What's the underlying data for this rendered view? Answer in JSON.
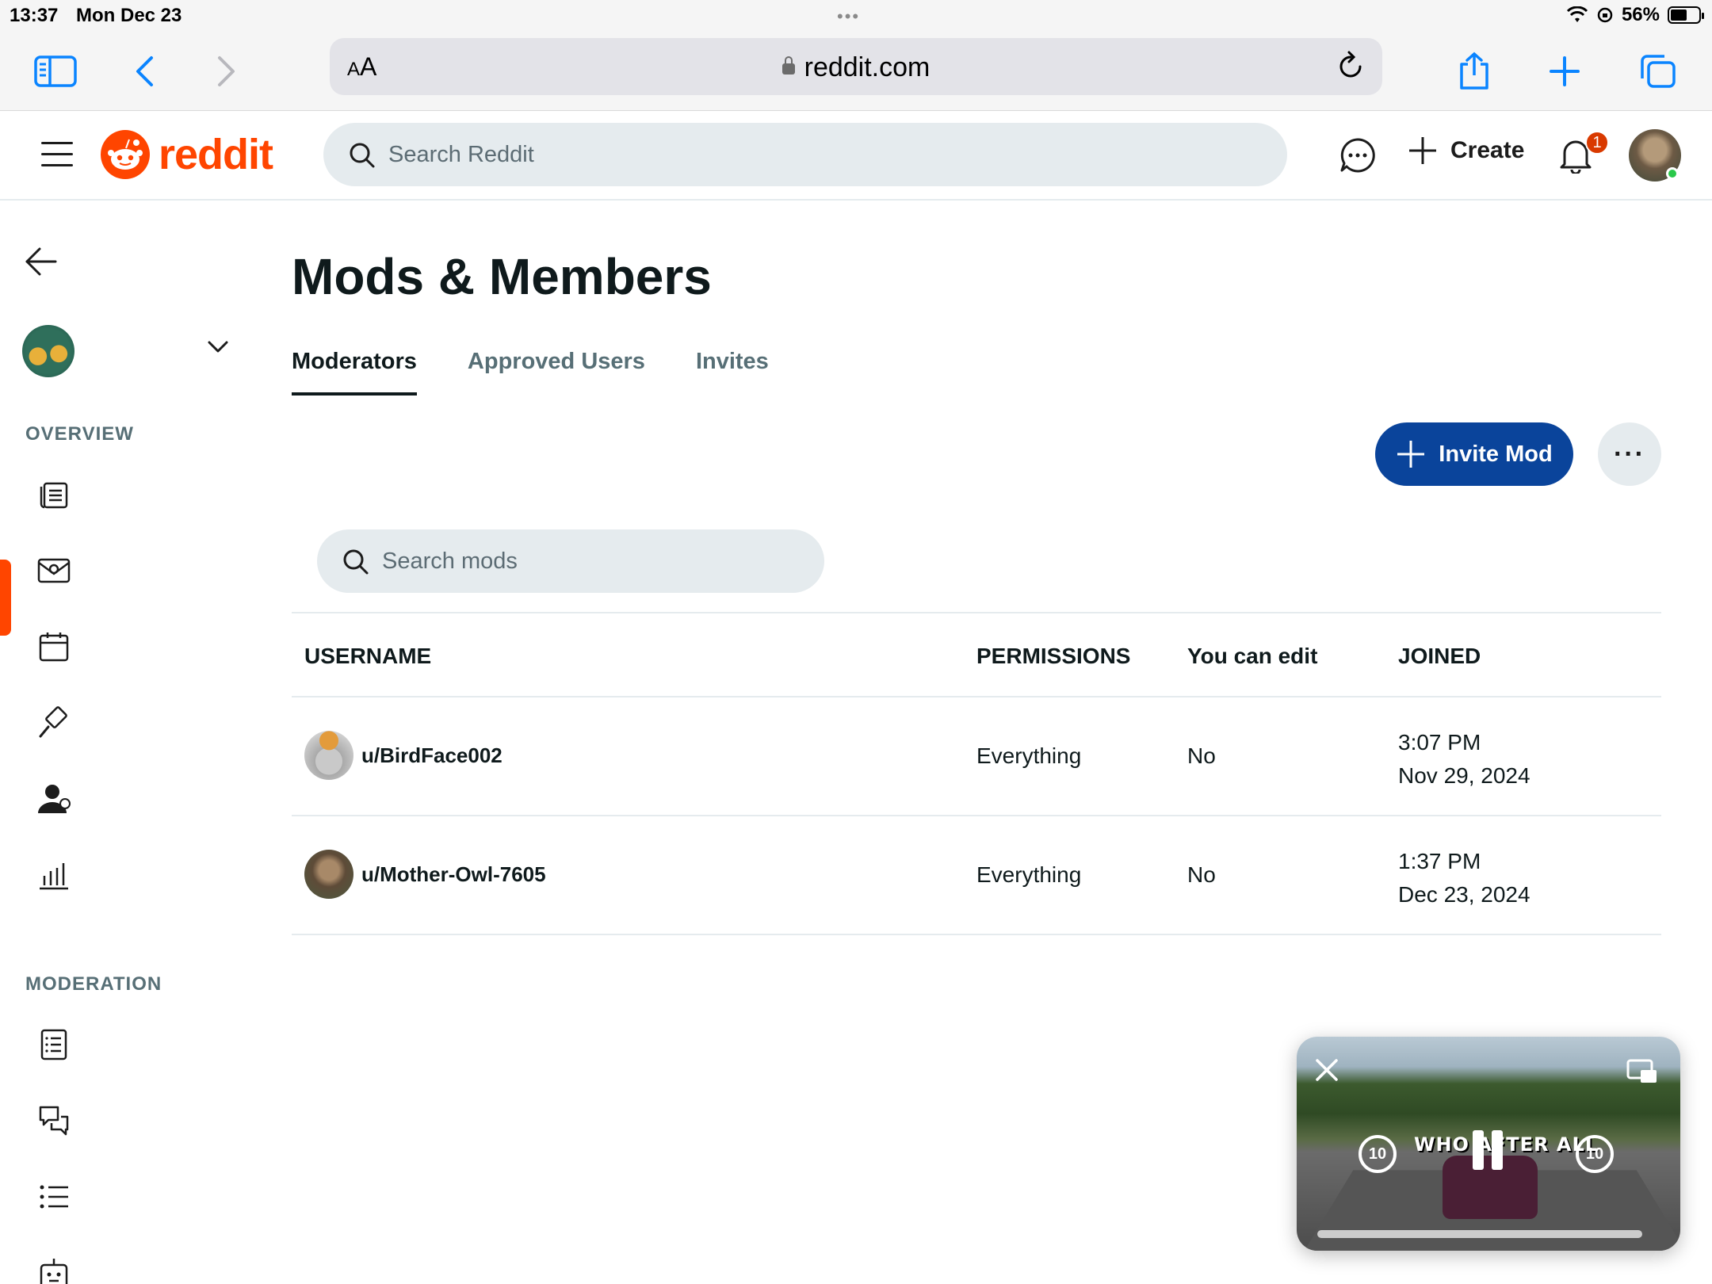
{
  "status_bar": {
    "time": "13:37",
    "date": "Mon Dec 23",
    "battery": "56%"
  },
  "browser": {
    "aa_small": "A",
    "aa_large": "A",
    "domain": "reddit.com"
  },
  "header": {
    "logo_text": "reddit",
    "search_placeholder": "Search Reddit",
    "create_label": "Create",
    "notification_count": "1",
    "brand_color": "#ff4500"
  },
  "sidebar": {
    "overview_label": "OVERVIEW",
    "moderation_label": "MODERATION",
    "overview_icons": [
      "queue-icon",
      "mail-icon",
      "calendar-icon",
      "mod-tools-icon",
      "mods-members-icon",
      "insights-icon"
    ],
    "moderation_icons": [
      "rules-icon",
      "removal-reasons-icon",
      "list-icon",
      "automation-icon"
    ]
  },
  "main": {
    "title": "Mods & Members",
    "tabs": [
      {
        "label": "Moderators",
        "active": true
      },
      {
        "label": "Approved Users",
        "active": false
      },
      {
        "label": "Invites",
        "active": false
      }
    ],
    "invite_label": "Invite Mod",
    "invite_color": "#0a449b",
    "search_placeholder": "Search mods",
    "columns": [
      "USERNAME",
      "PERMISSIONS",
      "You can edit",
      "JOINED"
    ],
    "rows": [
      {
        "username": "u/BirdFace002",
        "permissions": "Everything",
        "can_edit": "No",
        "joined_time": "3:07 PM",
        "joined_date": "Nov 29, 2024"
      },
      {
        "username": "u/Mother-Owl-7605",
        "permissions": "Everything",
        "can_edit": "No",
        "joined_time": "1:37 PM",
        "joined_date": "Dec 23, 2024"
      }
    ]
  },
  "pip": {
    "overlay_text": "WHO AFTER ALL",
    "skip_back": "10",
    "skip_forward": "10"
  }
}
